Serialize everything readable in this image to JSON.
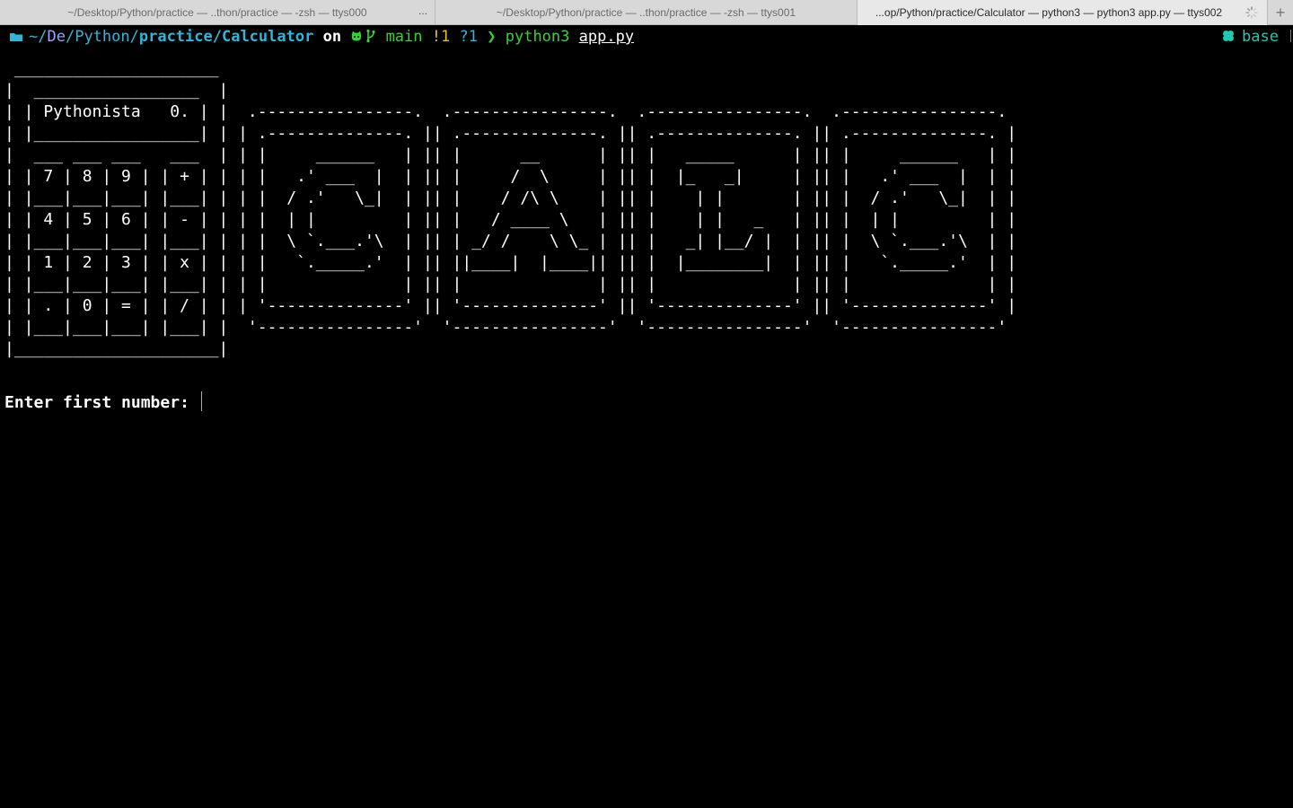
{
  "tabs": [
    {
      "title": "~/Desktop/Python/practice — ..thon/practice — -zsh — ttys000"
    },
    {
      "title": "~/Desktop/Python/practice — ..thon/practice — -zsh — ttys001"
    },
    {
      "title": "...op/Python/practice/Calculator — python3 — python3 app.py — ttys002"
    }
  ],
  "tab_overflow": "...",
  "new_tab_label": "+",
  "prompt": {
    "tilde": "~/",
    "de": "De",
    "path_mid": "/Python/",
    "path_bold": "practice/Calculator",
    "on": "on",
    "branch": "main",
    "modified": "!1",
    "untracked": "?1",
    "arrow": "❯",
    "command": "python3",
    "argument": "app.py"
  },
  "env": "base",
  "ascii_art": " _____________________\n|  _________________  |\n| | Pythonista   0. | |  .----------------.  .----------------.  .----------------.  .----------------.\n| |_________________| | | .--------------. || .--------------. || .--------------. || .--------------. |\n|  ___ ___ ___   ___  | | |     ______   | || |      __      | || |   _____      | || |     ______   | |\n| | 7 | 8 | 9 | | + | | | |   .' ___  |  | || |     /  \\     | || |  |_   _|     | || |   .' ___  |  | |\n| |___|___|___| |___| | | |  / .'   \\_|  | || |    / /\\ \\    | || |    | |       | || |  / .'   \\_|  | |\n| | 4 | 5 | 6 | | - | | | |  | |         | || |   / ____ \\   | || |    | |   _   | || |  | |         | |\n| |___|___|___| |___| | | |  \\ `.___.'\\  | || | _/ /    \\ \\_ | || |   _| |__/ |  | || |  \\ `.___.'\\  | |\n| | 1 | 2 | 3 | | x | | | |   `._____.'  | || ||____|  |____|| || |  |________|  | || |   `._____.'  | |\n| |___|___|___| |___| | | |              | || |              | || |              | || |              | |\n| | . | 0 | = | | / | | | '--------------' || '--------------' || '--------------' || '--------------' |\n| |___|___|___| |___| |  '----------------'  '----------------'  '----------------'  '----------------'\n|_____________________|",
  "input_prompt": "Enter first number: ",
  "colors": {
    "background": "#000000",
    "path": "#2fb6d8",
    "git": "#35d435",
    "modified": "#e8c21c",
    "env": "#1fc8b0"
  }
}
